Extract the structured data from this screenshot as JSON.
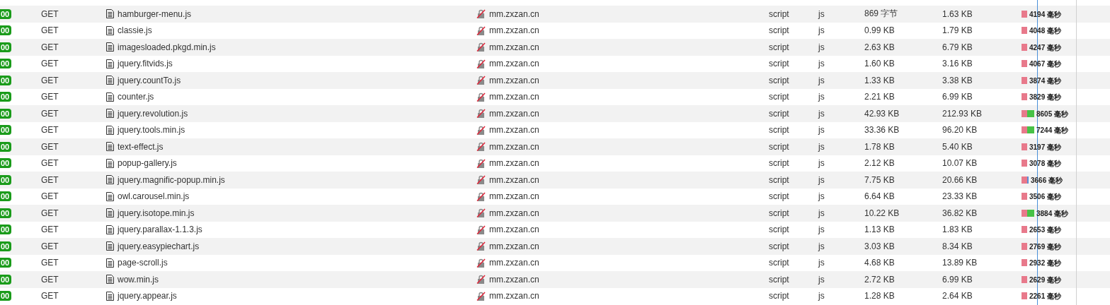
{
  "requests": [
    {
      "status": "00",
      "method": "GET",
      "file": "hamburger-menu.js",
      "domain": "mm.zxzan.cn",
      "type": "script",
      "ext": "js",
      "transferred": "869 字节",
      "size": "1.63 KB",
      "timings": [
        {
          "kind": "waiting"
        }
      ],
      "time": "4194 毫秒"
    },
    {
      "status": "00",
      "method": "GET",
      "file": "classie.js",
      "domain": "mm.zxzan.cn",
      "type": "script",
      "ext": "js",
      "transferred": "0.99 KB",
      "size": "1.79 KB",
      "timings": [
        {
          "kind": "waiting"
        }
      ],
      "time": "4048 毫秒"
    },
    {
      "status": "00",
      "method": "GET",
      "file": "imagesloaded.pkgd.min.js",
      "domain": "mm.zxzan.cn",
      "type": "script",
      "ext": "js",
      "transferred": "2.63 KB",
      "size": "6.79 KB",
      "timings": [
        {
          "kind": "waiting"
        }
      ],
      "time": "4247 毫秒"
    },
    {
      "status": "00",
      "method": "GET",
      "file": "jquery.fitvids.js",
      "domain": "mm.zxzan.cn",
      "type": "script",
      "ext": "js",
      "transferred": "1.60 KB",
      "size": "3.16 KB",
      "timings": [
        {
          "kind": "waiting"
        }
      ],
      "time": "4067 毫秒"
    },
    {
      "status": "00",
      "method": "GET",
      "file": "jquery.countTo.js",
      "domain": "mm.zxzan.cn",
      "type": "script",
      "ext": "js",
      "transferred": "1.33 KB",
      "size": "3.38 KB",
      "timings": [
        {
          "kind": "waiting"
        }
      ],
      "time": "3874 毫秒"
    },
    {
      "status": "00",
      "method": "GET",
      "file": "counter.js",
      "domain": "mm.zxzan.cn",
      "type": "script",
      "ext": "js",
      "transferred": "2.21 KB",
      "size": "6.99 KB",
      "timings": [
        {
          "kind": "waiting"
        }
      ],
      "time": "3829 毫秒"
    },
    {
      "status": "00",
      "method": "GET",
      "file": "jquery.revolution.js",
      "domain": "mm.zxzan.cn",
      "type": "script",
      "ext": "js",
      "transferred": "42.93 KB",
      "size": "212.93 KB",
      "timings": [
        {
          "kind": "waiting"
        },
        {
          "kind": "receiving"
        }
      ],
      "time": "8605 毫秒"
    },
    {
      "status": "00",
      "method": "GET",
      "file": "jquery.tools.min.js",
      "domain": "mm.zxzan.cn",
      "type": "script",
      "ext": "js",
      "transferred": "33.36 KB",
      "size": "96.20 KB",
      "timings": [
        {
          "kind": "waiting"
        },
        {
          "kind": "receiving"
        }
      ],
      "time": "7244 毫秒"
    },
    {
      "status": "00",
      "method": "GET",
      "file": "text-effect.js",
      "domain": "mm.zxzan.cn",
      "type": "script",
      "ext": "js",
      "transferred": "1.78 KB",
      "size": "5.40 KB",
      "timings": [
        {
          "kind": "waiting"
        }
      ],
      "time": "3197 毫秒"
    },
    {
      "status": "00",
      "method": "GET",
      "file": "popup-gallery.js",
      "domain": "mm.zxzan.cn",
      "type": "script",
      "ext": "js",
      "transferred": "2.12 KB",
      "size": "10.07 KB",
      "timings": [
        {
          "kind": "waiting"
        }
      ],
      "time": "3078 毫秒"
    },
    {
      "status": "00",
      "method": "GET",
      "file": "jquery.magnific-popup.min.js",
      "domain": "mm.zxzan.cn",
      "type": "script",
      "ext": "js",
      "transferred": "7.75 KB",
      "size": "20.66 KB",
      "timings": [
        {
          "kind": "waiting"
        },
        {
          "kind": "connecting"
        }
      ],
      "time": "3666 毫秒"
    },
    {
      "status": "00",
      "method": "GET",
      "file": "owl.carousel.min.js",
      "domain": "mm.zxzan.cn",
      "type": "script",
      "ext": "js",
      "transferred": "6.64 KB",
      "size": "23.33 KB",
      "timings": [
        {
          "kind": "waiting"
        }
      ],
      "time": "3506 毫秒"
    },
    {
      "status": "00",
      "method": "GET",
      "file": "jquery.isotope.min.js",
      "domain": "mm.zxzan.cn",
      "type": "script",
      "ext": "js",
      "transferred": "10.22 KB",
      "size": "36.82 KB",
      "timings": [
        {
          "kind": "waiting"
        },
        {
          "kind": "receiving"
        }
      ],
      "time": "3884 毫秒"
    },
    {
      "status": "00",
      "method": "GET",
      "file": "jquery.parallax-1.1.3.js",
      "domain": "mm.zxzan.cn",
      "type": "script",
      "ext": "js",
      "transferred": "1.13 KB",
      "size": "1.83 KB",
      "timings": [
        {
          "kind": "waiting"
        }
      ],
      "time": "2653 毫秒"
    },
    {
      "status": "00",
      "method": "GET",
      "file": "jquery.easypiechart.js",
      "domain": "mm.zxzan.cn",
      "type": "script",
      "ext": "js",
      "transferred": "3.03 KB",
      "size": "8.34 KB",
      "timings": [
        {
          "kind": "waiting"
        }
      ],
      "time": "2769 毫秒"
    },
    {
      "status": "00",
      "method": "GET",
      "file": "page-scroll.js",
      "domain": "mm.zxzan.cn",
      "type": "script",
      "ext": "js",
      "transferred": "4.68 KB",
      "size": "13.89 KB",
      "timings": [
        {
          "kind": "waiting"
        }
      ],
      "time": "2932 毫秒"
    },
    {
      "status": "00",
      "method": "GET",
      "file": "wow.min.js",
      "domain": "mm.zxzan.cn",
      "type": "script",
      "ext": "js",
      "transferred": "2.72 KB",
      "size": "6.99 KB",
      "timings": [
        {
          "kind": "waiting"
        }
      ],
      "time": "2629 毫秒"
    },
    {
      "status": "00",
      "method": "GET",
      "file": "jquery.appear.js",
      "domain": "mm.zxzan.cn",
      "type": "script",
      "ext": "js",
      "transferred": "1.28 KB",
      "size": "2.64 KB",
      "timings": [
        {
          "kind": "waiting"
        }
      ],
      "time": "2261 毫秒"
    }
  ]
}
